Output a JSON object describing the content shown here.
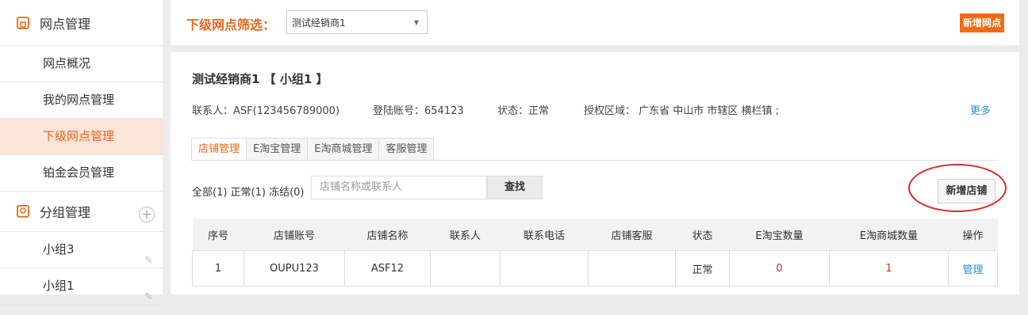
{
  "sidebar": {
    "section1": {
      "title": "网点管理",
      "icon": "store-icon"
    },
    "items": [
      {
        "label": "网点概况"
      },
      {
        "label": "我的网点管理"
      },
      {
        "label": "下级网点管理"
      },
      {
        "label": "铂金会员管理"
      }
    ],
    "section2": {
      "title": "分组管理",
      "icon": "group-icon",
      "add": "+"
    },
    "groups": [
      {
        "label": "小组3"
      },
      {
        "label": "小组1"
      }
    ]
  },
  "topbar": {
    "filter_label": "下级网点筛选：",
    "select_value": "测试经销商1",
    "add_button": "新增网点"
  },
  "main": {
    "title": "测试经销商1 【 小组1 】",
    "contact": "联系人：ASF(123456789000)",
    "login": "登陆账号：654123",
    "status": "状态：正常",
    "region": "授权区域： 广东省 中山市 市辖区 横栏镇 ;",
    "more": "更多",
    "tabs": [
      "店铺管理",
      "E淘宝管理",
      "E淘商城管理",
      "客服管理"
    ],
    "counts": "全部(1) 正常(1) 冻结(0)",
    "search_placeholder": "店铺名称或联系人",
    "search_button": "查找",
    "add_shop": "新增店铺",
    "table": {
      "headers": [
        "序号",
        "店铺账号",
        "店铺名称",
        "联系人",
        "联系电话",
        "店铺客服",
        "状态",
        "E淘宝数量",
        "E淘商城数量",
        "操作"
      ],
      "rows": [
        [
          "1",
          "OUPU123",
          "ASF12",
          "",
          "",
          "",
          "正常",
          "0",
          "1",
          "管理"
        ]
      ]
    }
  }
}
